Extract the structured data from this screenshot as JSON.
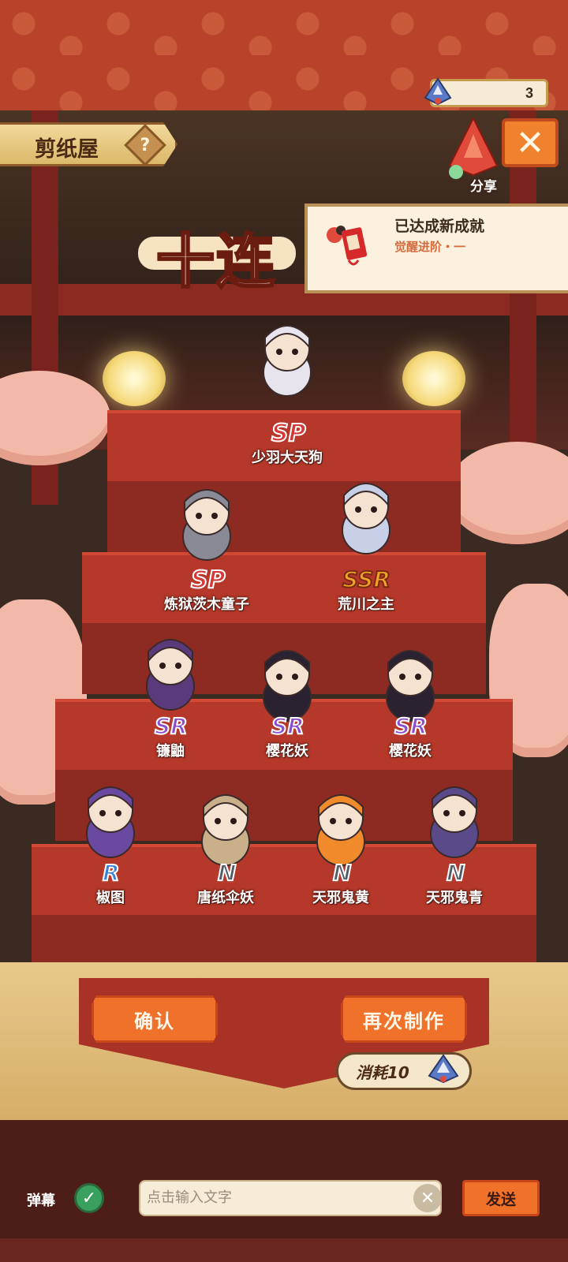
{
  "header": {
    "currency_count": "3",
    "title": "剪纸屋",
    "help_symbol": "?",
    "close_symbol": "✕",
    "share_label": "分享"
  },
  "achievement": {
    "title": "已达成新成就",
    "subtitle": "觉醒进阶・一"
  },
  "banner_title": "十连",
  "characters": [
    {
      "rarity": "SP",
      "name": "少羽大天狗"
    },
    {
      "rarity": "SP",
      "name": "炼狱茨木童子"
    },
    {
      "rarity": "SSR",
      "name": "荒川之主"
    },
    {
      "rarity": "SR",
      "name": "镰鼬"
    },
    {
      "rarity": "SR",
      "name": "樱花妖"
    },
    {
      "rarity": "SR",
      "name": "樱花妖"
    },
    {
      "rarity": "R",
      "name": "椒图"
    },
    {
      "rarity": "N",
      "name": "唐纸伞妖"
    },
    {
      "rarity": "N",
      "name": "天邪鬼黄"
    },
    {
      "rarity": "N",
      "name": "天邪鬼青"
    }
  ],
  "buttons": {
    "confirm": "确认",
    "make_again": "再次制作",
    "cost": "消耗10"
  },
  "chat": {
    "danmu_label": "弹幕",
    "input_placeholder": "点击输入文字",
    "send": "发送",
    "clear_symbol": "✕",
    "check_symbol": "✓"
  },
  "colors": {
    "accent": "#f0712a",
    "sp": "#d63838",
    "ssr": "#f2a22a",
    "sr": "#8a4bd0",
    "r": "#3b7ed8",
    "n": "#505a66"
  }
}
